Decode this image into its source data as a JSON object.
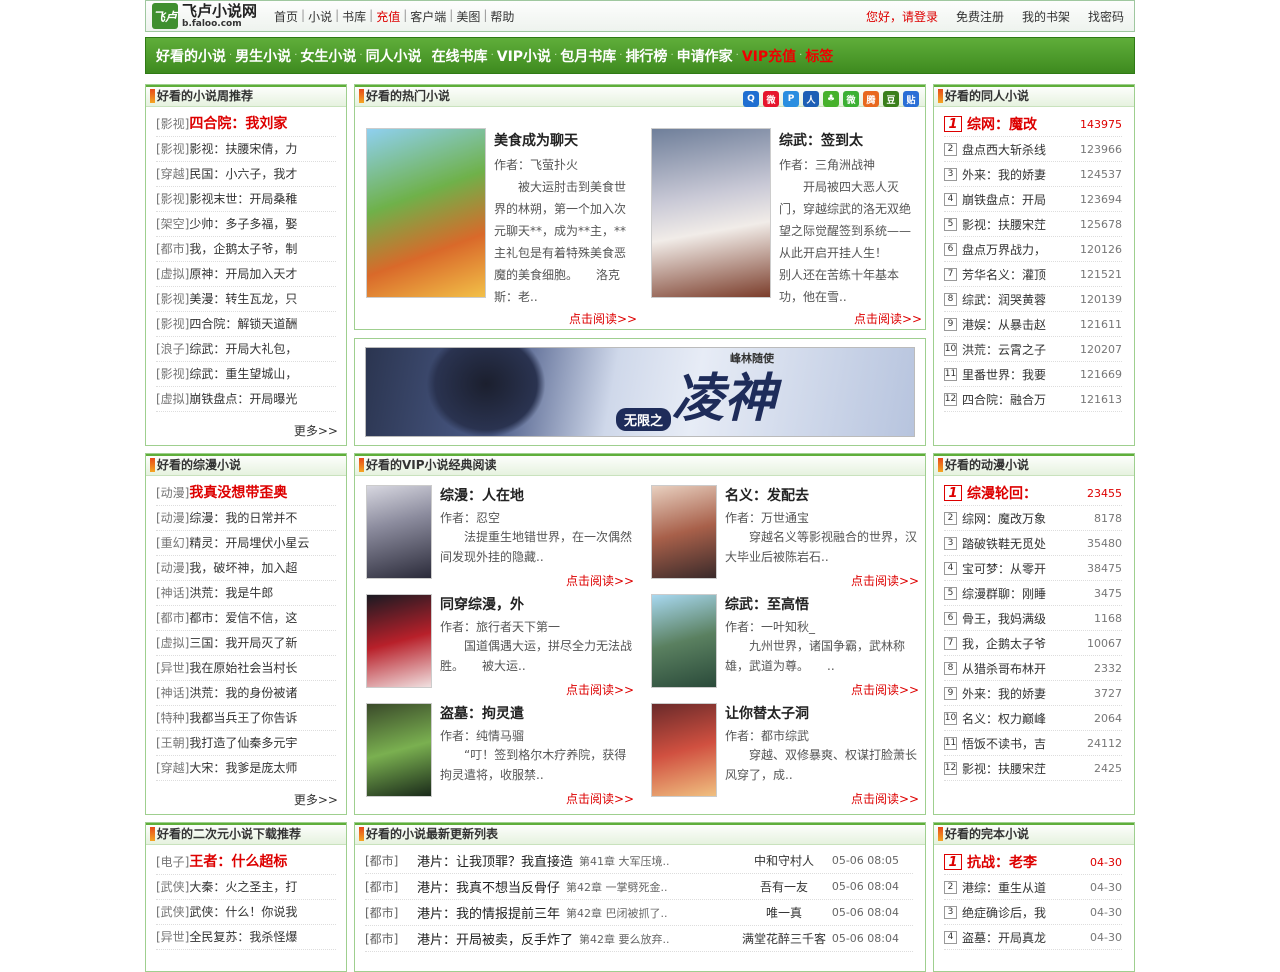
{
  "top": {
    "logo_main": "飞卢小说网",
    "logo_sub": "b.faloo.com",
    "logo_mark": "飞卢",
    "nav": [
      "首页",
      "小说",
      "书库",
      "充值",
      "客户端",
      "美图",
      "帮助"
    ],
    "login": "您好，请登录",
    "register": "免费注册",
    "shelf": "我的书架",
    "findpwd": "找密码"
  },
  "mainnav": [
    "好看的小说",
    "男生小说",
    "女生小说",
    "同人小说",
    "在线书库",
    "VIP小说",
    "包月书库",
    "排行榜",
    "申请作家",
    "VIP充值",
    "标签"
  ],
  "weekly": {
    "title": "好看的小说周推荐",
    "items": [
      {
        "cat": "[影视]",
        "name": "四合院：我刘家"
      },
      {
        "cat": "[影视]",
        "name": "影视：扶腰宋倩，力"
      },
      {
        "cat": "[穿越]",
        "name": "民国：小六子，我才"
      },
      {
        "cat": "[影视]",
        "name": "影视末世：开局桑稚"
      },
      {
        "cat": "[架空]",
        "name": "少帅：多子多福，娶"
      },
      {
        "cat": "[都市]",
        "name": "我，企鹅太子爷，制"
      },
      {
        "cat": "[虚拟]",
        "name": "原神：开局加入天才"
      },
      {
        "cat": "[影视]",
        "name": "美漫：转生瓦龙，只"
      },
      {
        "cat": "[影视]",
        "name": "四合院：解锁天道酬"
      },
      {
        "cat": "[浪子]",
        "name": "综武：开局大礼包，"
      },
      {
        "cat": "[影视]",
        "name": "综武：重生望城山，"
      },
      {
        "cat": "[虚拟]",
        "name": "崩铁盘点：开局曝光"
      }
    ],
    "more": "更多>>"
  },
  "hot": {
    "title": "好看的热门小说",
    "books": [
      {
        "title": "美食成为聊天",
        "author": "作者：飞萤扑火",
        "desc": "被大运肘击到美食世界的林朔，第一个加入次元聊天**，成为**主，**主礼包是有着特殊美食恶魔的美食细胞。　　洛克斯：老..",
        "more": "点击阅读>>"
      },
      {
        "title": "综武：签到太",
        "author": "作者：三角洲战神",
        "desc": "开局被四大恶人灭门，穿越综武的洛无双绝望之际觉醒签到系统——从此开启开挂人生！　　别人还在苦练十年基本功，他在雪..",
        "more": "点击阅读>>"
      }
    ]
  },
  "banner": {
    "tag": "峰林随使",
    "title": "凌神",
    "sub": "无限之"
  },
  "tongren": {
    "title": "好看的同人小说",
    "items": [
      {
        "name": "综网：魔改",
        "val": "143975"
      },
      {
        "name": "盘点西大斩杀线",
        "val": "123966"
      },
      {
        "name": "外来：我的娇妻",
        "val": "124537"
      },
      {
        "name": "崩铁盘点：开局",
        "val": "123694"
      },
      {
        "name": "影视：扶腰宋茳",
        "val": "125678"
      },
      {
        "name": "盘点万界战力，",
        "val": "120126"
      },
      {
        "name": "芳华名义：灌顶",
        "val": "121521"
      },
      {
        "name": "综武：润哭黄蓉",
        "val": "120139"
      },
      {
        "name": "港娱：从暴击赵",
        "val": "121611"
      },
      {
        "name": "洪荒：云霄之子",
        "val": "120207"
      },
      {
        "name": "里番世界：我要",
        "val": "121669"
      },
      {
        "name": "四合院：融合万",
        "val": "121613"
      }
    ]
  },
  "zongman": {
    "title": "好看的综漫小说",
    "items": [
      {
        "cat": "[动漫]",
        "name": "我真没想带歪奥"
      },
      {
        "cat": "[动漫]",
        "name": "综漫：我的日常并不"
      },
      {
        "cat": "[重幻]",
        "name": "精灵：开局埋伏小星云"
      },
      {
        "cat": "[动漫]",
        "name": "我，破坏神，加入超"
      },
      {
        "cat": "[神话]",
        "name": "洪荒：我是牛郎"
      },
      {
        "cat": "[都市]",
        "name": "都市：爱信不信，这"
      },
      {
        "cat": "[虚拟]",
        "name": "三国：我开局灭了新"
      },
      {
        "cat": "[异世]",
        "name": "我在原始社会当村长"
      },
      {
        "cat": "[神话]",
        "name": "洪荒：我的身份被诸"
      },
      {
        "cat": "[特种]",
        "name": "我都当兵王了你告诉"
      },
      {
        "cat": "[王朝]",
        "name": "我打造了仙秦多元宇"
      },
      {
        "cat": "[穿越]",
        "name": "大宋：我爹是庞太师"
      }
    ],
    "more": "更多>>"
  },
  "vip": {
    "title": "好看的VIP小说经典阅读",
    "books": [
      {
        "title": "综漫：人在地",
        "author": "作者：忍空",
        "desc": "法提重生地错世界，在一次偶然间发现外挂的隐藏..",
        "more": "点击阅读>>"
      },
      {
        "title": "名义：发配去",
        "author": "作者：万世通宝",
        "desc": "穿越名义等影视融合的世界，汉大毕业后被陈岩石..",
        "more": "点击阅读>>"
      },
      {
        "title": "同穿综漫，外",
        "author": "作者：旅行者天下第一",
        "desc": "国道偶遇大运，拼尽全力无法战胜。　　被大运..",
        "more": "点击阅读>>"
      },
      {
        "title": "综武：至高悟",
        "author": "作者：一叶知秋_",
        "desc": "九州世界，诸国争霸，武林称雄，武道为尊。　　..",
        "more": "点击阅读>>"
      },
      {
        "title": "盗墓：拘灵遣",
        "author": "作者：纯情马骝",
        "desc": "“叮！签到格尔木疗养院，获得拘灵遣将，收服禁..",
        "more": "点击阅读>>"
      },
      {
        "title": "让你替太子洞",
        "author": "作者：都市综武",
        "desc": "穿越、双修暴爽、权谋打脸萧长风穿了，成..",
        "more": "点击阅读>>"
      }
    ]
  },
  "dongman": {
    "title": "好看的动漫小说",
    "items": [
      {
        "name": "综漫轮回：",
        "val": "23455"
      },
      {
        "name": "综网：魔改万象",
        "val": "8178"
      },
      {
        "name": "踏破铁鞋无觅处",
        "val": "35480"
      },
      {
        "name": "宝可梦：从零开",
        "val": "38475"
      },
      {
        "name": "综漫群聊：刚睡",
        "val": "3475"
      },
      {
        "name": "骨王，我妈满级",
        "val": "1168"
      },
      {
        "name": "我，企鹅太子爷",
        "val": "10067"
      },
      {
        "name": "从猎杀哥布林开",
        "val": "2332"
      },
      {
        "name": "外来：我的娇妻",
        "val": "3727"
      },
      {
        "name": "名义：权力巅峰",
        "val": "2064"
      },
      {
        "name": "悟饭不读书，吉",
        "val": "24112"
      },
      {
        "name": "影视：扶腰宋茳",
        "val": "2425"
      }
    ]
  },
  "erci": {
    "title": "好看的二次元小说下载推荐",
    "items": [
      {
        "cat": "[电子]",
        "name": "王者：什么超标"
      },
      {
        "cat": "[武侠]",
        "name": "大秦：火之圣主，打"
      },
      {
        "cat": "[武侠]",
        "name": "武侠：什么！你说我"
      },
      {
        "cat": "[异世]",
        "name": "全民复苏：我杀怪爆"
      }
    ]
  },
  "updates": {
    "title": "好看的小说最新更新列表",
    "rows": [
      {
        "cat": "[都市]",
        "book": "港片：让我顶罪？我直接造",
        "ch": "第41章 大军压境..",
        "au": "中和守村人",
        "tm": "05-06 08:05"
      },
      {
        "cat": "[都市]",
        "book": "港片：我真不想当反骨仔",
        "ch": "第42章 一掌劈死金..",
        "au": "吾有一友",
        "tm": "05-06 08:04"
      },
      {
        "cat": "[都市]",
        "book": "港片：我的情报提前三年",
        "ch": "第42章 巴闭被抓了..",
        "au": "唯一真",
        "tm": "05-06 08:04"
      },
      {
        "cat": "[都市]",
        "book": "港片：开局被卖，反手炸了",
        "ch": "第42章 要么放弃..",
        "au": "满堂花醉三千客",
        "tm": "05-06 08:04"
      }
    ]
  },
  "wanben": {
    "title": "好看的完本小说",
    "items": [
      {
        "name": "抗战：老李",
        "val": "04-30"
      },
      {
        "name": "港综：重生从道",
        "val": "04-30"
      },
      {
        "name": "绝症确诊后，我",
        "val": "04-30"
      },
      {
        "name": "盗墓：开局真龙",
        "val": "04-30"
      }
    ]
  }
}
